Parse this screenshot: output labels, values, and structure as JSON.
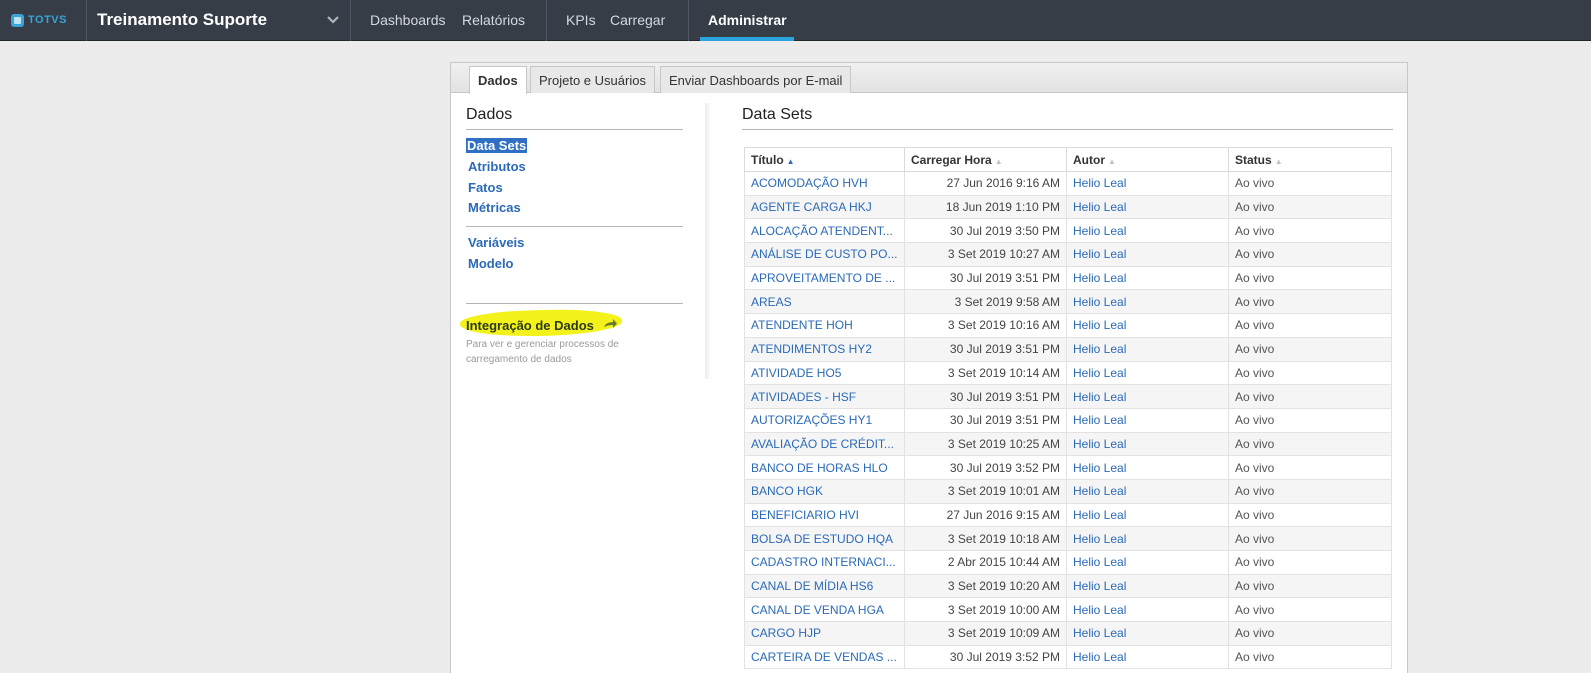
{
  "header": {
    "logo_text": "TOTVS",
    "project_title": "Treinamento Suporte",
    "nav": [
      "Dashboards",
      "Relatórios",
      "KPIs",
      "Carregar",
      "Administrar"
    ],
    "active_nav": "Administrar"
  },
  "tabs": [
    "Dados",
    "Projeto e Usuários",
    "Enviar Dashboards por E-mail"
  ],
  "left": {
    "title": "Dados",
    "links_group1": [
      "Data Sets",
      "Atributos",
      "Fatos",
      "Métricas"
    ],
    "links_group2": [
      "Variáveis",
      "Modelo"
    ],
    "integration_label": "Integração de Dados",
    "integration_desc": "Para ver e gerenciar processos de carregamento de dados"
  },
  "right": {
    "title": "Data Sets",
    "columns": [
      "Título",
      "Carregar Hora",
      "Autor",
      "Status"
    ],
    "rows": [
      {
        "title": "ACOMODAÇÃO HVH",
        "date": "27 Jun 2016 9:16 AM",
        "author": "Helio Leal",
        "status": "Ao vivo"
      },
      {
        "title": "AGENTE CARGA HKJ",
        "date": "18 Jun 2019 1:10 PM",
        "author": "Helio Leal",
        "status": "Ao vivo"
      },
      {
        "title": "ALOCAÇÃO ATENDENT...",
        "date": "30 Jul 2019 3:50 PM",
        "author": "Helio Leal",
        "status": "Ao vivo"
      },
      {
        "title": "ANÁLISE DE CUSTO PO...",
        "date": "3 Set 2019 10:27 AM",
        "author": "Helio Leal",
        "status": "Ao vivo"
      },
      {
        "title": "APROVEITAMENTO DE ...",
        "date": "30 Jul 2019 3:51 PM",
        "author": "Helio Leal",
        "status": "Ao vivo"
      },
      {
        "title": "AREAS",
        "date": "3 Set 2019 9:58 AM",
        "author": "Helio Leal",
        "status": "Ao vivo"
      },
      {
        "title": "ATENDENTE HOH",
        "date": "3 Set 2019 10:16 AM",
        "author": "Helio Leal",
        "status": "Ao vivo"
      },
      {
        "title": "ATENDIMENTOS HY2",
        "date": "30 Jul 2019 3:51 PM",
        "author": "Helio Leal",
        "status": "Ao vivo"
      },
      {
        "title": "ATIVIDADE HO5",
        "date": "3 Set 2019 10:14 AM",
        "author": "Helio Leal",
        "status": "Ao vivo"
      },
      {
        "title": "ATIVIDADES - HSF",
        "date": "30 Jul 2019 3:51 PM",
        "author": "Helio Leal",
        "status": "Ao vivo"
      },
      {
        "title": "AUTORIZAÇÕES HY1",
        "date": "30 Jul 2019 3:51 PM",
        "author": "Helio Leal",
        "status": "Ao vivo"
      },
      {
        "title": "AVALIAÇÃO DE CRÉDIT...",
        "date": "3 Set 2019 10:25 AM",
        "author": "Helio Leal",
        "status": "Ao vivo"
      },
      {
        "title": "BANCO DE HORAS HLO",
        "date": "30 Jul 2019 3:52 PM",
        "author": "Helio Leal",
        "status": "Ao vivo"
      },
      {
        "title": "BANCO HGK",
        "date": "3 Set 2019 10:01 AM",
        "author": "Helio Leal",
        "status": "Ao vivo"
      },
      {
        "title": "BENEFICIARIO HVI",
        "date": "27 Jun 2016 9:15 AM",
        "author": "Helio Leal",
        "status": "Ao vivo"
      },
      {
        "title": "BOLSA DE ESTUDO HQA",
        "date": "3 Set 2019 10:18 AM",
        "author": "Helio Leal",
        "status": "Ao vivo"
      },
      {
        "title": "CADASTRO INTERNACI...",
        "date": "2 Abr 2015 10:44 AM",
        "author": "Helio Leal",
        "status": "Ao vivo"
      },
      {
        "title": "CANAL DE MÍDIA HS6",
        "date": "3 Set 2019 10:20 AM",
        "author": "Helio Leal",
        "status": "Ao vivo"
      },
      {
        "title": "CANAL DE VENDA HGA",
        "date": "3 Set 2019 10:00 AM",
        "author": "Helio Leal",
        "status": "Ao vivo"
      },
      {
        "title": "CARGO HJP",
        "date": "3 Set 2019 10:09 AM",
        "author": "Helio Leal",
        "status": "Ao vivo"
      },
      {
        "title": "CARTEIRA DE VENDAS ...",
        "date": "30 Jul 2019 3:52 PM",
        "author": "Helio Leal",
        "status": "Ao vivo"
      }
    ]
  }
}
